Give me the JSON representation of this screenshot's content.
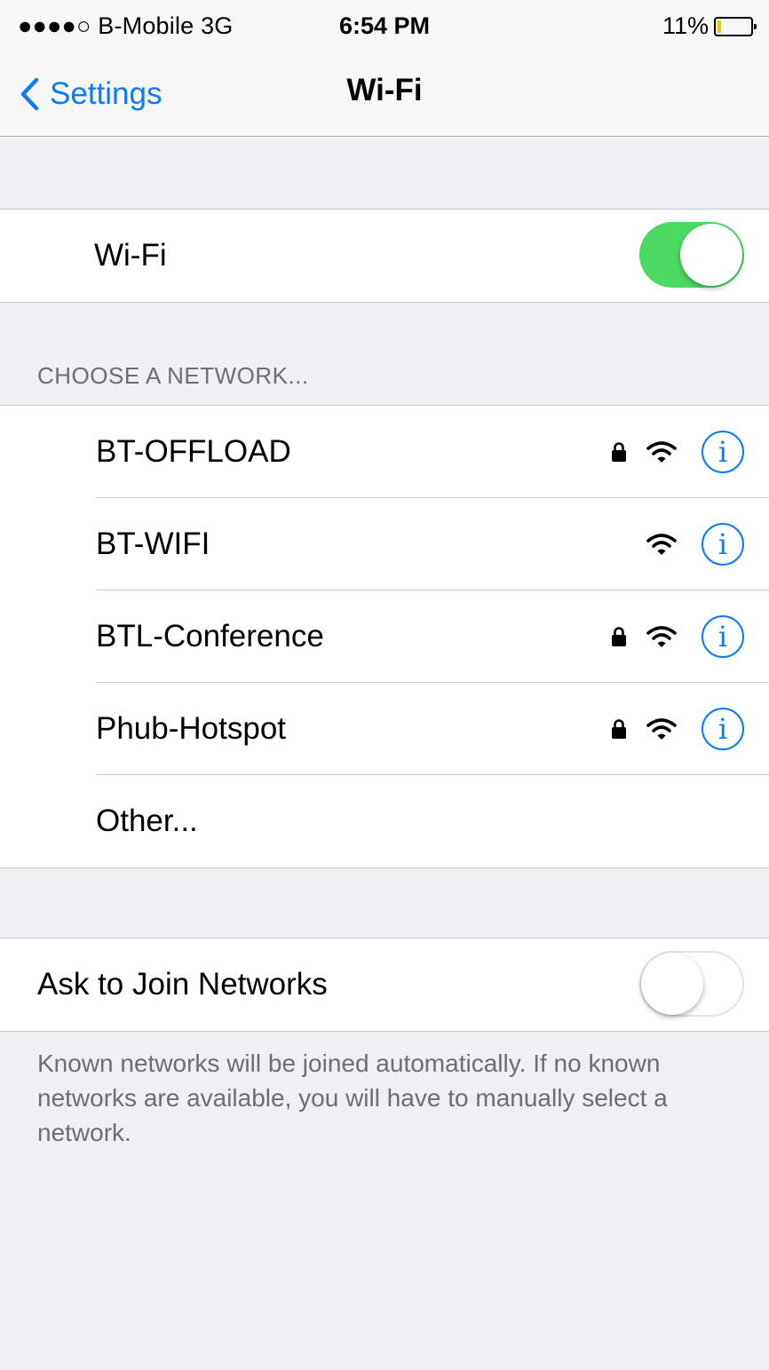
{
  "status_bar": {
    "carrier": "●●●●○ B-Mobile  3G",
    "time": "6:54 PM",
    "battery_percent": "11%",
    "battery_level": 0.11,
    "battery_color": "#f5c500"
  },
  "nav": {
    "back_label": "Settings",
    "title": "Wi-Fi",
    "accent_color": "#0a7aff"
  },
  "wifi_toggle": {
    "label": "Wi-Fi",
    "state": "on",
    "on_color": "#4cd964"
  },
  "network_section_header": "CHOOSE A NETWORK...",
  "networks": [
    {
      "name": "BT-OFFLOAD",
      "locked": true,
      "signal": "full",
      "icons": [
        "lock-icon",
        "wifi-signal-icon",
        "info-icon"
      ]
    },
    {
      "name": "BT-WIFI",
      "locked": false,
      "signal": "full",
      "icons": [
        "wifi-signal-icon",
        "info-icon"
      ]
    },
    {
      "name": "BTL-Conference",
      "locked": true,
      "signal": "full",
      "icons": [
        "lock-icon",
        "wifi-signal-icon",
        "info-icon"
      ]
    },
    {
      "name": "Phub-Hotspot",
      "locked": true,
      "signal": "full",
      "icons": [
        "lock-icon",
        "wifi-signal-icon",
        "info-icon"
      ]
    }
  ],
  "other_label": "Other...",
  "ask_to_join": {
    "label": "Ask to Join Networks",
    "state": "off"
  },
  "footer_note": "Known networks will be joined automatically. If no known networks are available, you will have to manually select a network.",
  "info_glyph": "i"
}
